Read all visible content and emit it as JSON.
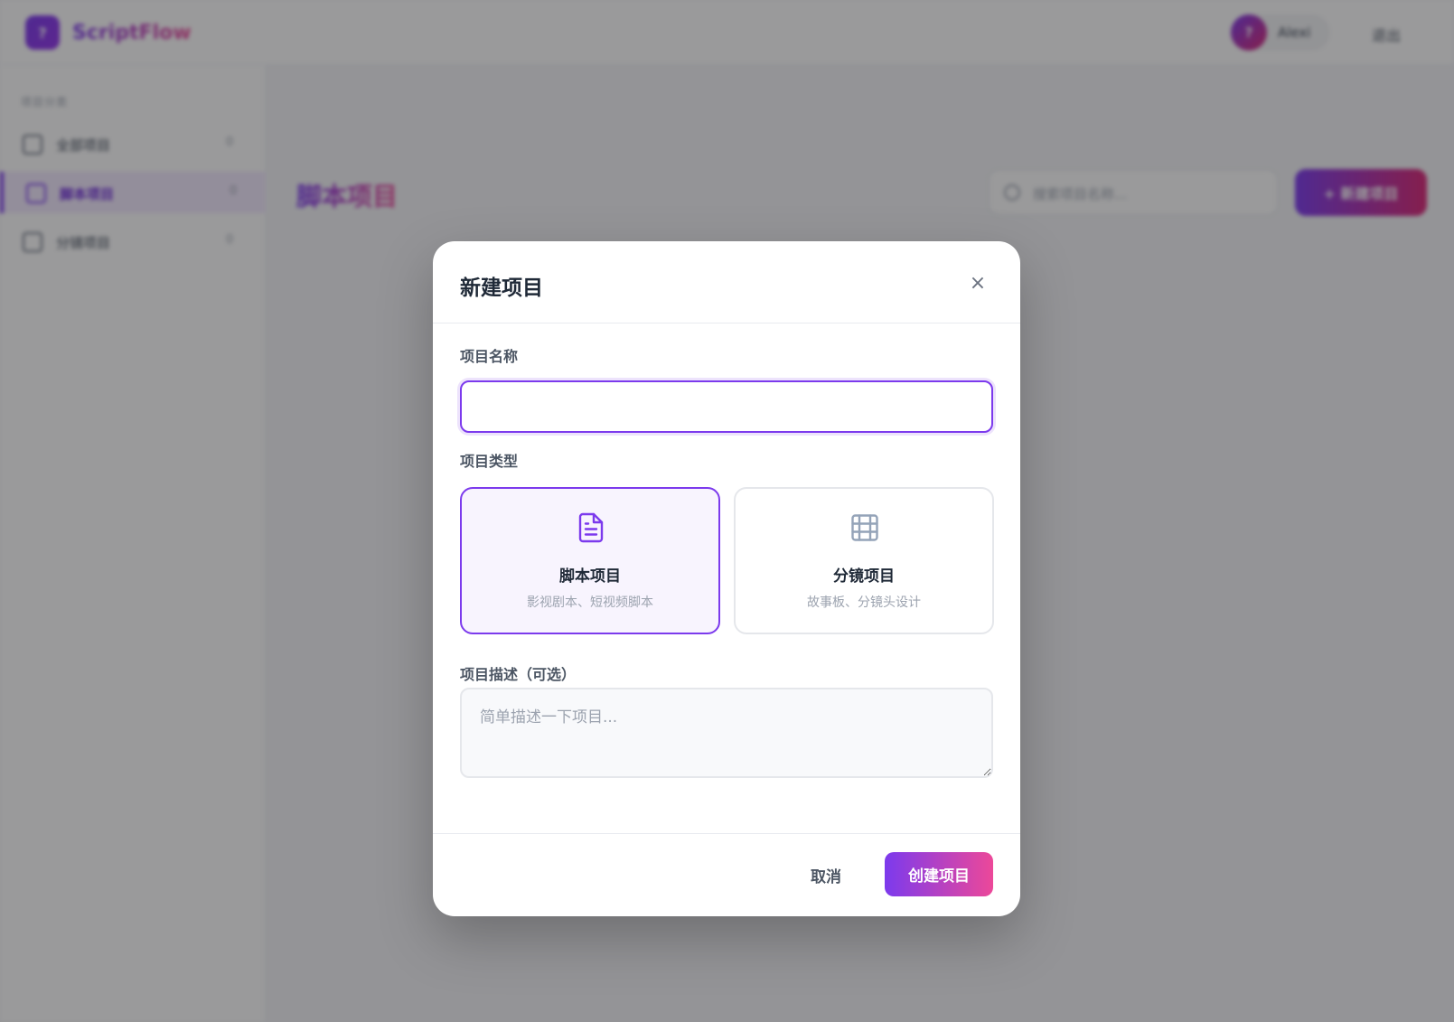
{
  "app": {
    "logo_letter": "?",
    "name": "ScriptFlow",
    "user_initial": "?",
    "user_name": "Alexi",
    "logout_label": "退出"
  },
  "sidebar": {
    "heading": "项目分类",
    "items": [
      {
        "label": "全部项目",
        "count": "0",
        "icon": "grid-icon",
        "active": false
      },
      {
        "label": "脚本项目",
        "count": "0",
        "icon": "document-icon",
        "active": true
      },
      {
        "label": "分镜项目",
        "count": "0",
        "icon": "storyboard-icon",
        "active": false
      }
    ]
  },
  "main": {
    "title": "脚本项目",
    "search_placeholder": "搜索项目名称...",
    "new_button_label": "+ 新建项目"
  },
  "modal": {
    "title": "新建项目",
    "close_symbol": "×",
    "name_label": "项目名称",
    "name_value": "",
    "type_label": "项目类型",
    "types": [
      {
        "name": "脚本项目",
        "desc": "影视剧本、短视频脚本",
        "icon": "document-icon",
        "selected": true
      },
      {
        "name": "分镜项目",
        "desc": "故事板、分镜头设计",
        "icon": "storyboard-grid-icon",
        "selected": false
      }
    ],
    "desc_label": "项目描述（可选）",
    "desc_placeholder": "简单描述一下项目...",
    "cancel_label": "取消",
    "create_label": "创建项目"
  },
  "colors": {
    "accent": "#7c3aed",
    "accent_end": "#ec4899",
    "selected_card_bg": "#f8f4fe"
  }
}
